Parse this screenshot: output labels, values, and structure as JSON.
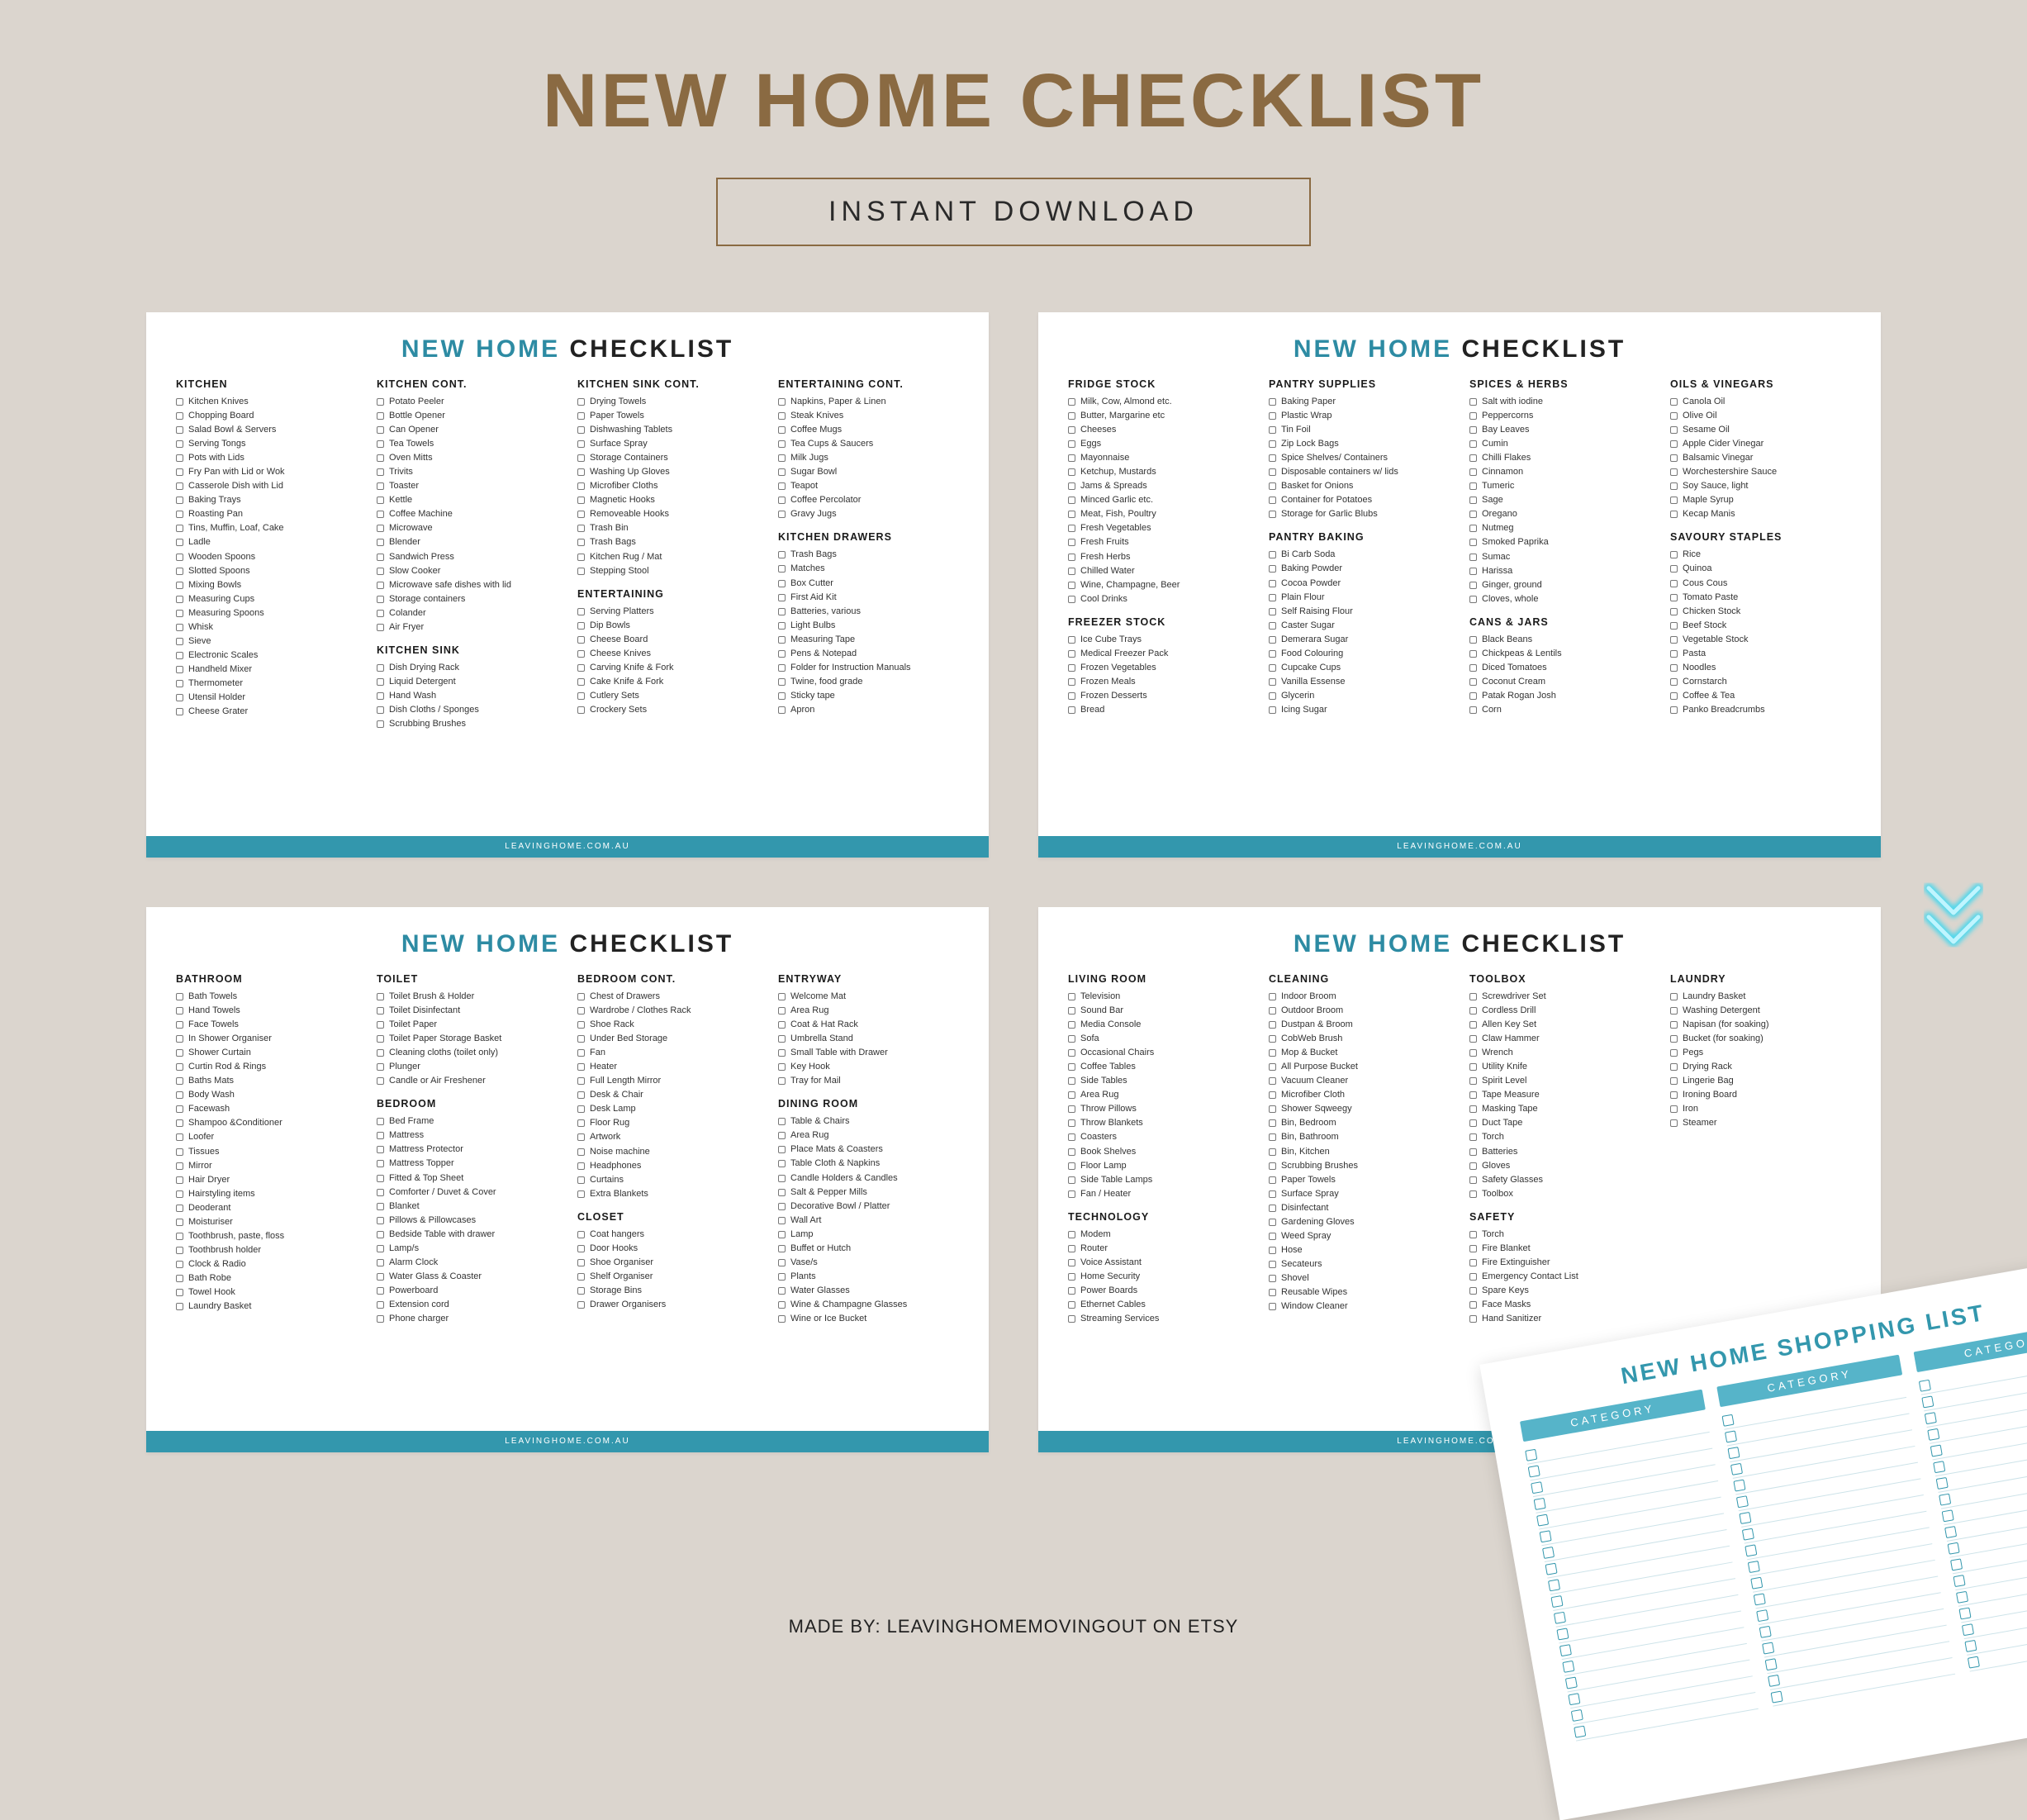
{
  "main_title": "NEW HOME CHECKLIST",
  "subtitle": "INSTANT DOWNLOAD",
  "page_title_accent": "NEW HOME",
  "page_title_dark": "CHECKLIST",
  "footer_text": "LEAVINGHOME.COM.AU",
  "credit": "MADE BY: LEAVINGHOMEMOVINGOUT ON ETSY",
  "shopping_title": "NEW HOME SHOPPING LIST",
  "shopping_header": "CATEGORY",
  "pages": [
    {
      "columns": [
        [
          {
            "heading": "KITCHEN",
            "items": [
              "Kitchen Knives",
              "Chopping Board",
              "Salad Bowl & Servers",
              "Serving Tongs",
              "Pots with Lids",
              "Fry Pan with Lid or Wok",
              "Casserole Dish with Lid",
              "Baking Trays",
              "Roasting Pan",
              "Tins, Muffin, Loaf, Cake",
              "Ladle",
              "Wooden Spoons",
              "Slotted Spoons",
              "Mixing Bowls",
              "Measuring Cups",
              "Measuring Spoons",
              "Whisk",
              "Sieve",
              "Electronic Scales",
              "Handheld Mixer",
              "Thermometer",
              "Utensil Holder",
              "Cheese Grater"
            ]
          }
        ],
        [
          {
            "heading": "KITCHEN CONT.",
            "items": [
              "Potato Peeler",
              "Bottle Opener",
              "Can Opener",
              "Tea Towels",
              "Oven Mitts",
              "Trivits",
              "Toaster",
              "Kettle",
              "Coffee Machine",
              "Microwave",
              "Blender",
              "Sandwich Press",
              "Slow Cooker",
              "Microwave safe dishes with lid",
              "Storage containers",
              "Colander",
              "Air Fryer"
            ]
          },
          {
            "heading": "KITCHEN SINK",
            "items": [
              "Dish Drying Rack",
              "Liquid Detergent",
              "Hand Wash",
              "Dish Cloths / Sponges",
              "Scrubbing Brushes"
            ]
          }
        ],
        [
          {
            "heading": "KITCHEN SINK CONT.",
            "items": [
              "Drying Towels",
              "Paper Towels",
              "Dishwashing Tablets",
              "Surface Spray",
              "Storage Containers",
              "Washing Up Gloves",
              "Microfiber Cloths",
              "Magnetic Hooks",
              "Removeable Hooks",
              "Trash Bin",
              "Trash Bags",
              "Kitchen Rug / Mat",
              "Stepping Stool"
            ]
          },
          {
            "heading": "ENTERTAINING",
            "items": [
              "Serving Platters",
              "Dip Bowls",
              "Cheese Board",
              "Cheese Knives",
              "Carving Knife & Fork",
              "Cake Knife & Fork",
              "Cutlery Sets",
              "Crockery Sets"
            ]
          }
        ],
        [
          {
            "heading": "ENTERTAINING CONT.",
            "items": [
              "Napkins, Paper & Linen",
              "Steak Knives",
              "Coffee Mugs",
              "Tea Cups & Saucers",
              "Milk Jugs",
              "Sugar Bowl",
              "Teapot",
              "Coffee Percolator",
              "Gravy Jugs"
            ]
          },
          {
            "heading": "KITCHEN DRAWERS",
            "items": [
              "Trash Bags",
              "Matches",
              "Box Cutter",
              "First Aid Kit",
              "Batteries, various",
              "Light Bulbs",
              "Measuring Tape",
              "Pens & Notepad",
              "Folder for Instruction Manuals",
              "Twine, food grade",
              "Sticky tape",
              "Apron"
            ]
          }
        ]
      ]
    },
    {
      "columns": [
        [
          {
            "heading": "FRIDGE STOCK",
            "items": [
              "Milk, Cow, Almond etc.",
              "Butter, Margarine etc",
              "Cheeses",
              "Eggs",
              "Mayonnaise",
              "Ketchup, Mustards",
              "Jams & Spreads",
              "Minced Garlic etc.",
              "Meat, Fish, Poultry",
              "Fresh Vegetables",
              "Fresh Fruits",
              "Fresh Herbs",
              "Chilled Water",
              "Wine, Champagne, Beer",
              "Cool Drinks"
            ]
          },
          {
            "heading": "FREEZER STOCK",
            "items": [
              "Ice Cube Trays",
              "Medical Freezer Pack",
              "Frozen Vegetables",
              "Frozen Meals",
              "Frozen Desserts",
              "Bread"
            ]
          }
        ],
        [
          {
            "heading": "PANTRY SUPPLIES",
            "items": [
              "Baking Paper",
              "Plastic Wrap",
              "Tin Foil",
              "Zip Lock Bags",
              "Spice Shelves/ Containers",
              "Disposable containers w/ lids",
              "Basket for Onions",
              "Container for Potatoes",
              "Storage for Garlic Blubs"
            ]
          },
          {
            "heading": "PANTRY BAKING",
            "items": [
              "Bi Carb Soda",
              "Baking Powder",
              "Cocoa Powder",
              "Plain Flour",
              "Self Raising Flour",
              "Caster Sugar",
              "Demerara Sugar",
              "Food Colouring",
              "Cupcake Cups",
              "Vanilla Essense",
              "Glycerin",
              "Icing Sugar"
            ]
          }
        ],
        [
          {
            "heading": "SPICES & HERBS",
            "items": [
              "Salt with iodine",
              "Peppercorns",
              "Bay Leaves",
              "Cumin",
              "Chilli Flakes",
              "Cinnamon",
              "Tumeric",
              "Sage",
              "Oregano",
              "Nutmeg",
              "Smoked Paprika",
              "Sumac",
              "Harissa",
              "Ginger, ground",
              "Cloves, whole"
            ]
          },
          {
            "heading": "CANS & JARS",
            "items": [
              "Black Beans",
              "Chickpeas & Lentils",
              "Diced Tomatoes",
              "Coconut Cream",
              "Patak Rogan Josh",
              "Corn"
            ]
          }
        ],
        [
          {
            "heading": "OILS & VINEGARS",
            "items": [
              "Canola Oil",
              "Olive Oil",
              "Sesame Oil",
              "Apple Cider Vinegar",
              "Balsamic Vinegar",
              "Worchestershire Sauce",
              "Soy Sauce, light",
              "Maple Syrup",
              "Kecap Manis"
            ]
          },
          {
            "heading": "SAVOURY STAPLES",
            "items": [
              "Rice",
              "Quinoa",
              "Cous Cous",
              "Tomato Paste",
              "Chicken Stock",
              "Beef Stock",
              "Vegetable Stock",
              "Pasta",
              "Noodles",
              "Cornstarch",
              "Coffee & Tea",
              "Panko Breadcrumbs"
            ]
          }
        ]
      ]
    },
    {
      "columns": [
        [
          {
            "heading": "BATHROOM",
            "items": [
              "Bath Towels",
              "Hand Towels",
              "Face Towels",
              "In Shower Organiser",
              "Shower Curtain",
              "Curtin Rod & Rings",
              "Baths Mats",
              "Body Wash",
              "Facewash",
              "Shampoo &Conditioner",
              "Loofer",
              "Tissues",
              "Mirror",
              "Hair Dryer",
              "Hairstyling items",
              "Deoderant",
              "Moisturiser",
              "Toothbrush, paste, floss",
              "Toothbrush holder",
              "Clock & Radio",
              "Bath Robe",
              "Towel Hook",
              "Laundry Basket"
            ]
          }
        ],
        [
          {
            "heading": "TOILET",
            "items": [
              "Toilet Brush & Holder",
              "Toilet Disinfectant",
              "Toilet Paper",
              "Toilet Paper Storage Basket",
              "Cleaning cloths (toilet only)",
              "Plunger",
              "Candle or Air Freshener"
            ]
          },
          {
            "heading": "BEDROOM",
            "items": [
              "Bed Frame",
              "Mattress",
              "Mattress Protector",
              "Mattress Topper",
              "Fitted & Top Sheet",
              "Comforter / Duvet & Cover",
              "Blanket",
              "Pillows & Pillowcases",
              "Bedside Table with drawer",
              "Lamp/s",
              "Alarm Clock",
              "Water Glass & Coaster",
              "Powerboard",
              "Extension cord",
              "Phone charger"
            ]
          }
        ],
        [
          {
            "heading": "BEDROOM CONT.",
            "items": [
              "Chest of Drawers",
              "Wardrobe / Clothes Rack",
              "Shoe Rack",
              "Under Bed Storage",
              "Fan",
              "Heater",
              "Full Length Mirror",
              "Desk & Chair",
              "Desk Lamp",
              "Floor Rug",
              "Artwork",
              "Noise machine",
              "Headphones",
              "Curtains",
              "Extra Blankets"
            ]
          },
          {
            "heading": "CLOSET",
            "items": [
              "Coat hangers",
              "Door Hooks",
              "Shoe Organiser",
              "Shelf Organiser",
              "Storage Bins",
              "Drawer Organisers"
            ]
          }
        ],
        [
          {
            "heading": "ENTRYWAY",
            "items": [
              "Welcome Mat",
              "Area Rug",
              "Coat & Hat Rack",
              "Umbrella Stand",
              "Small Table with Drawer",
              "Key Hook",
              "Tray for Mail"
            ]
          },
          {
            "heading": "DINING ROOM",
            "items": [
              "Table & Chairs",
              "Area Rug",
              "Place Mats & Coasters",
              "Table Cloth & Napkins",
              "Candle Holders & Candles",
              "Salt & Pepper Mills",
              "Decorative Bowl / Platter",
              "Wall Art",
              "Lamp",
              "Buffet or Hutch",
              "Vase/s",
              "Plants",
              "Water Glasses",
              "Wine & Champagne Glasses",
              "Wine or Ice Bucket"
            ]
          }
        ]
      ]
    },
    {
      "columns": [
        [
          {
            "heading": "LIVING ROOM",
            "items": [
              "Television",
              "Sound Bar",
              "Media Console",
              "Sofa",
              "Occasional Chairs",
              "Coffee Tables",
              "Side Tables",
              "Area Rug",
              "Throw Pillows",
              "Throw Blankets",
              "Coasters",
              "Book Shelves",
              "Floor Lamp",
              "Side Table Lamps",
              "Fan / Heater"
            ]
          },
          {
            "heading": "TECHNOLOGY",
            "items": [
              "Modem",
              "Router",
              "Voice Assistant",
              "Home Security",
              "Power Boards",
              "Ethernet Cables",
              "Streaming Services"
            ]
          }
        ],
        [
          {
            "heading": "CLEANING",
            "items": [
              "Indoor Broom",
              "Outdoor Broom",
              "Dustpan & Broom",
              "CobWeb Brush",
              "Mop & Bucket",
              "All Purpose Bucket",
              "Vacuum Cleaner",
              "Microfiber Cloth",
              "Shower Sqweegy",
              "Bin, Bedroom",
              "Bin, Bathroom",
              "Bin, Kitchen",
              "Scrubbing Brushes",
              "Paper Towels",
              "Surface Spray",
              "Disinfectant",
              "Gardening Gloves",
              "Weed Spray",
              "Hose",
              "Secateurs",
              "Shovel",
              "Reusable Wipes",
              "Window Cleaner"
            ]
          }
        ],
        [
          {
            "heading": "TOOLBOX",
            "items": [
              "Screwdriver Set",
              "Cordless Drill",
              "Allen Key Set",
              "Claw Hammer",
              "Wrench",
              "Utility Knife",
              "Spirit Level",
              "Tape Measure",
              "Masking Tape",
              "Duct Tape",
              "Torch",
              "Batteries",
              "Gloves",
              "Safety Glasses",
              "Toolbox"
            ]
          },
          {
            "heading": "SAFETY",
            "items": [
              "Torch",
              "Fire Blanket",
              "Fire Extinguisher",
              "Emergency Contact List",
              "Spare Keys",
              "Face Masks",
              "Hand Sanitizer"
            ]
          }
        ],
        [
          {
            "heading": "LAUNDRY",
            "items": [
              "Laundry Basket",
              "Washing Detergent",
              "Napisan (for soaking)",
              "Bucket (for soaking)",
              "Pegs",
              "Drying Rack",
              "Lingerie Bag",
              "Ironing Board",
              "Iron",
              "Steamer"
            ]
          }
        ]
      ]
    }
  ]
}
